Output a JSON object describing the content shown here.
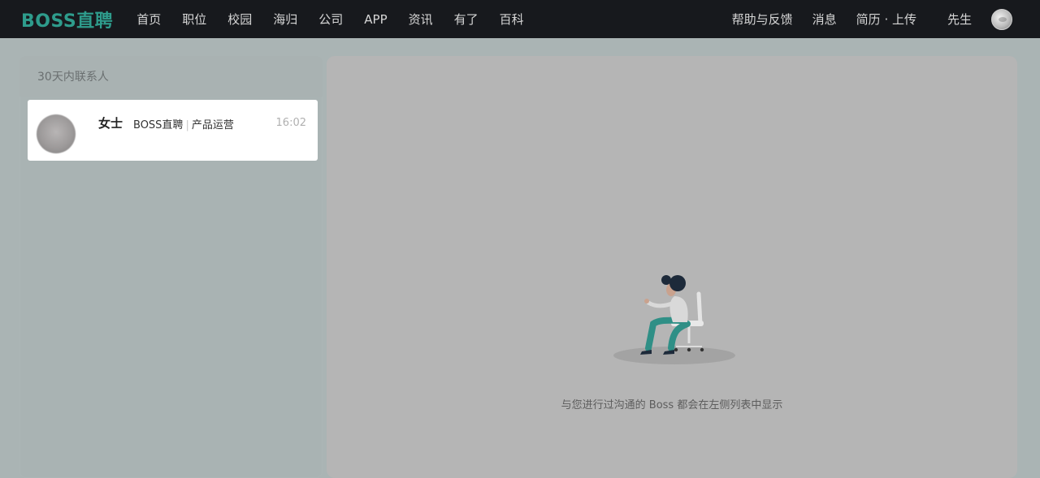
{
  "brand": {
    "logo_text": "BOSS直聘",
    "accent_color": "#2e9c8c"
  },
  "nav": {
    "items": [
      {
        "label": "首页"
      },
      {
        "label": "职位"
      },
      {
        "label": "校园"
      },
      {
        "label": "海归"
      },
      {
        "label": "公司"
      },
      {
        "label": "APP"
      },
      {
        "label": "资讯"
      },
      {
        "label": "有了"
      },
      {
        "label": "百科"
      }
    ],
    "right": {
      "help": "帮助与反馈",
      "messages": "消息",
      "resume": "简历 · 上传",
      "user_name": "先生"
    }
  },
  "contacts": {
    "header": "30天内联系人",
    "items": [
      {
        "name": "女士",
        "company": "BOSS直聘",
        "separator": "|",
        "position": "产品运营",
        "time": "16:02"
      }
    ]
  },
  "main": {
    "empty_message": "与您进行过沟通的 Boss 都会在左侧列表中显示",
    "illustration_icon": "woman-on-chair-illustration"
  }
}
